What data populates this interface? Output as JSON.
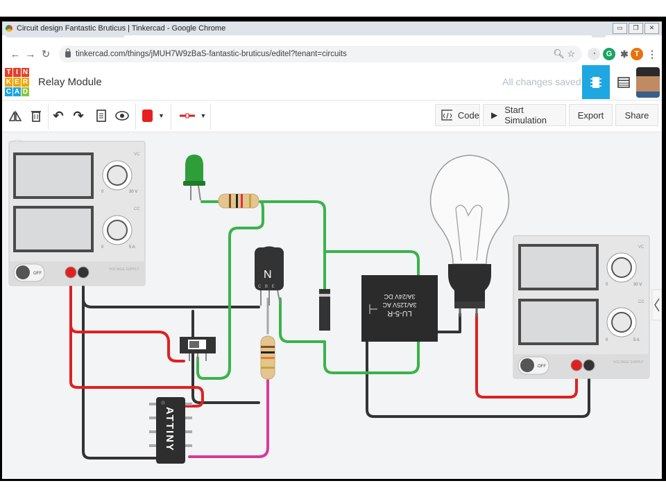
{
  "window": {
    "title": "Circuit design Fantastic Bruticus | Tinkercad - Google Chrome",
    "controls": [
      "▭",
      "❐",
      "✕"
    ]
  },
  "browser": {
    "url": "tinkercad.com/things/jMUH7W9zBaS-fantastic-bruticus/editel?tenant=circuits",
    "profile_initial": "T",
    "ext_initial": "G"
  },
  "app": {
    "logo_letters": [
      "TIN",
      "KER",
      "CAD"
    ],
    "logo_colors": [
      "#e23f2d",
      "#f3a300",
      "#1fa3e0",
      "#8cc63e"
    ],
    "project_name": "Relay Module",
    "save_status": "All changes saved",
    "accent": "#1ea7e1"
  },
  "toolbar": {
    "code_label": "Code",
    "start_sim_label": "Start Simulation",
    "export_label": "Export",
    "share_label": "Share",
    "fill_color": "#e62020",
    "wire_color": "#d62020"
  },
  "circuit": {
    "supply_left": {
      "knob1_min": "0",
      "knob1_max": "30 V",
      "knob1_tag": "VC",
      "knob2_min": "0",
      "knob2_max": "5 A",
      "knob2_tag": "CC",
      "switch_label": "OFF",
      "footer": "VOLTAGE SUPPLY"
    },
    "supply_right": {
      "knob1_min": "0",
      "knob1_max": "30 V",
      "knob1_tag": "VC",
      "knob2_min": "0",
      "knob2_max": "5 A",
      "knob2_tag": "CC",
      "switch_label": "OFF",
      "footer": "VOLTAGE SUPPLY"
    },
    "transistor_label": "N",
    "transistor_pins": "C B E",
    "relay_lines": [
      "LU-5-R",
      "3A/125V AC",
      "3A/24V DC"
    ],
    "chip_label": "ATTINY"
  }
}
